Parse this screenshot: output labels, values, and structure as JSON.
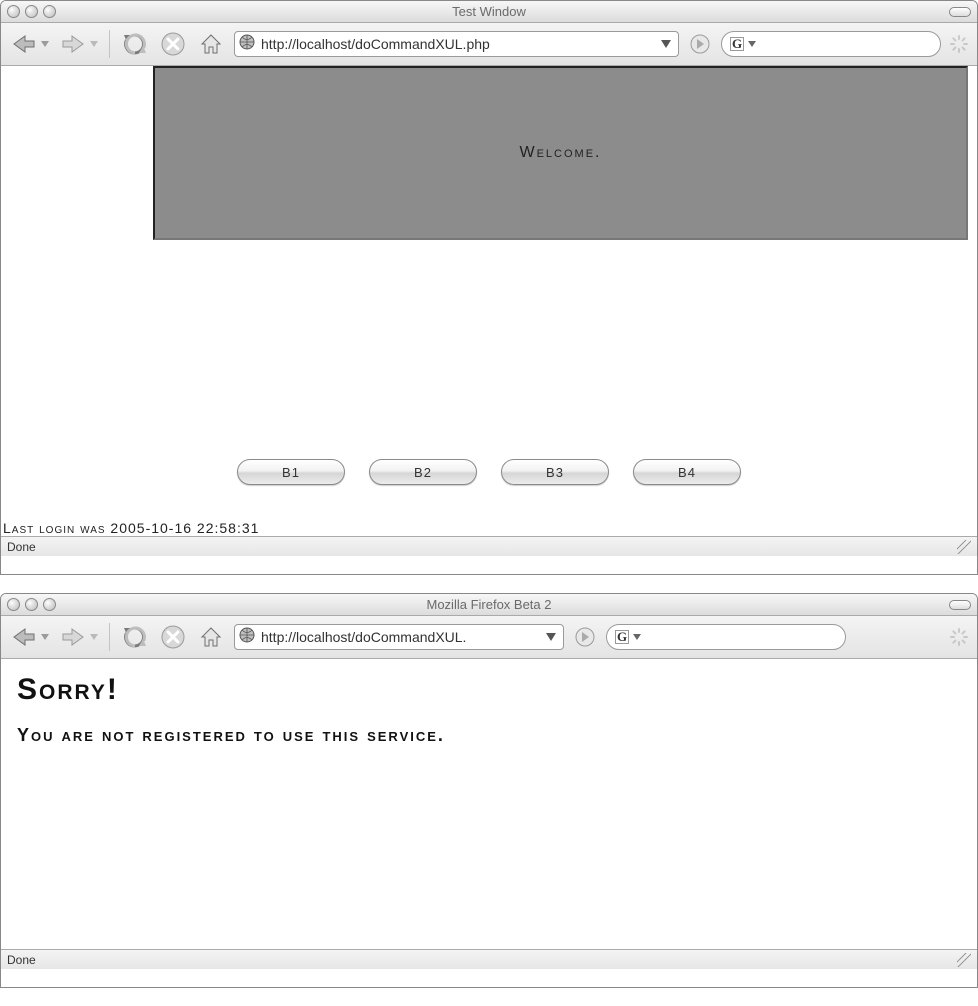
{
  "window1": {
    "title": "Test Window",
    "url": "http://localhost/doCommandXUL.php",
    "search_engine_letter": "G",
    "welcome_text": "Welcome.",
    "buttons": [
      "B1",
      "B2",
      "B3",
      "B4"
    ],
    "last_login_label": "Last login was 2005-10-16 22:58:31",
    "status": "Done"
  },
  "window2": {
    "title": "Mozilla Firefox Beta 2",
    "url": "http://localhost/doCommandXUL.",
    "search_engine_letter": "G",
    "heading": "Sorry!",
    "message": "You are not registered to use this service.",
    "status": "Done"
  }
}
